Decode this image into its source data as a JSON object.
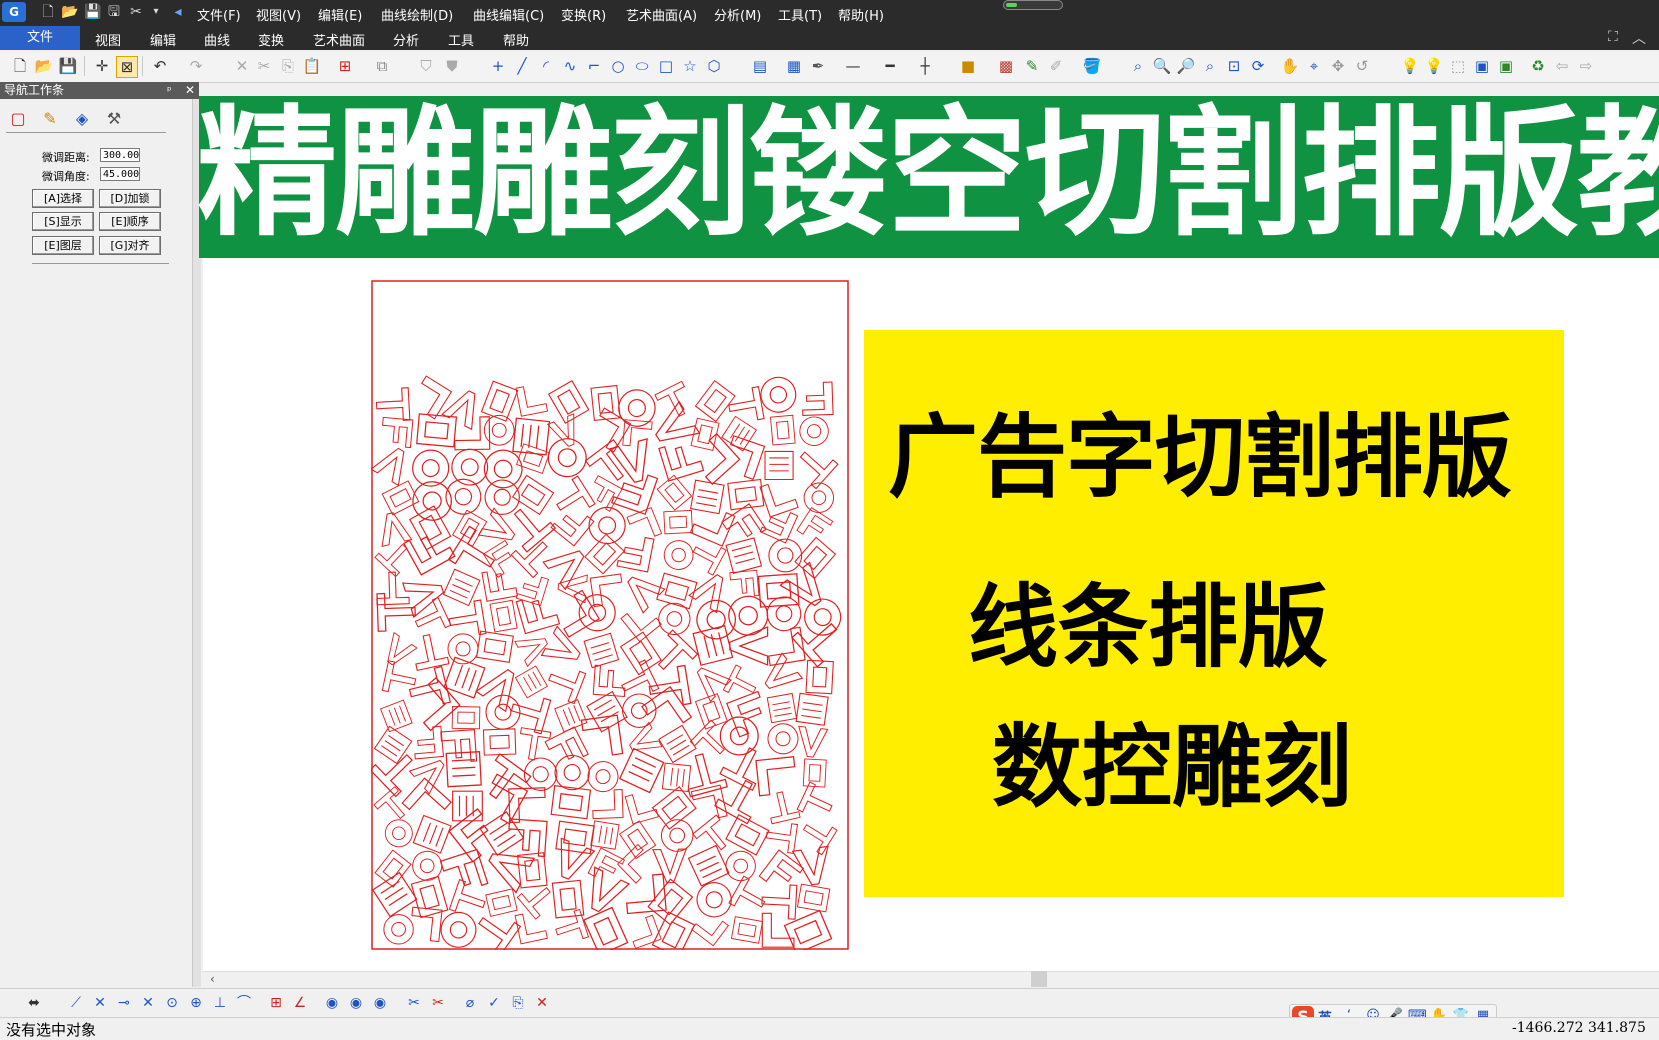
{
  "app": {
    "logo_glyph": "G"
  },
  "quick_access": [
    {
      "name": "new-file-icon",
      "glyph": "🗋"
    },
    {
      "name": "open-folder-icon",
      "glyph": "📂"
    },
    {
      "name": "save-icon",
      "glyph": "💾"
    },
    {
      "name": "save-as-icon",
      "glyph": "🖫"
    },
    {
      "name": "tools-icon",
      "glyph": "✂"
    },
    {
      "name": "dropdown-icon",
      "glyph": "▾"
    },
    {
      "name": "back-arrow-icon",
      "glyph": "◂"
    }
  ],
  "menu": [
    "文件(F)",
    "视图(V)",
    "编辑(E)",
    "曲线绘制(D)",
    "曲线编辑(C)",
    "变换(R)",
    "艺术曲面(A)",
    "分析(M)",
    "工具(T)",
    "帮助(H)"
  ],
  "progress": {
    "fraction": 0.2
  },
  "ribbon": {
    "active": "文件",
    "tabs": [
      "视图",
      "编辑",
      "曲线",
      "变换",
      "艺术曲面",
      "分析",
      "工具",
      "帮助"
    ]
  },
  "window_controls": {
    "maximize": "⛶",
    "collapse": "︿"
  },
  "navigator": {
    "title": "导航工作条",
    "pin": "ᵖ",
    "close": "✕",
    "tabs": [
      {
        "name": "layer-tab-icon",
        "glyph": "▢"
      },
      {
        "name": "edit-tab-icon",
        "glyph": "✎"
      },
      {
        "name": "surface-tab-icon",
        "glyph": "◈"
      },
      {
        "name": "tool-tab-icon",
        "glyph": "⚒"
      }
    ],
    "fields": [
      {
        "label": "微调距离:",
        "value": "300.00"
      },
      {
        "label": "微调角度:",
        "value": "45.000"
      }
    ],
    "buttons": [
      "[A]选择",
      "[D]加锁",
      "[S]显示",
      "[E]顺序",
      "[E]图层",
      "[G]对齐"
    ]
  },
  "banner": {
    "text": "精雕雕刻镂空切割排版教程",
    "bg": "#0f9241"
  },
  "poster": {
    "title": "广告字切割排版",
    "line2": "线条排版",
    "line3": "数控雕刻",
    "bg": "#ffee00"
  },
  "sheet": {
    "stroke": "#e02020"
  },
  "status": {
    "text": "没有选中对象",
    "coords": "-1466.272  341.875"
  },
  "ime": {
    "logo": "S",
    "lang": "英"
  }
}
